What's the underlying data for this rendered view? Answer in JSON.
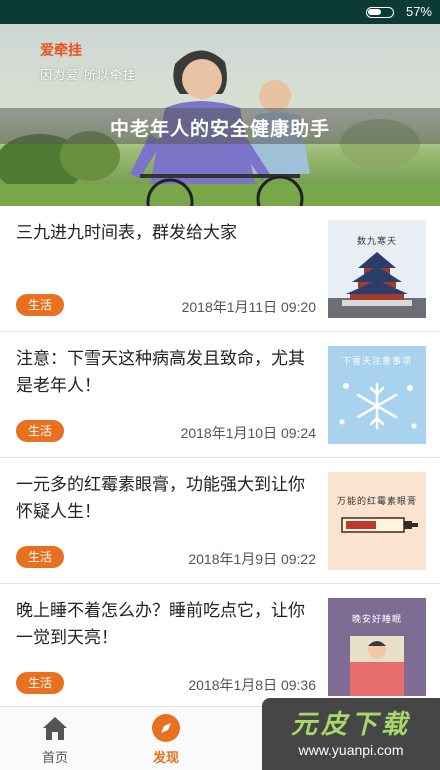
{
  "status_bar": {
    "battery_percent": 57,
    "battery_text": "57%"
  },
  "banner": {
    "brand": "爱牵挂",
    "slogan": "因为爱 所以牵挂",
    "caption": "中老年人的安全健康助手"
  },
  "articles": [
    {
      "title": "三九进九时间表，群发给大家",
      "tag": "生活",
      "date": "2018年1月11日 09:20",
      "thumb_text": "数九寒天",
      "thumb_icon": "temple-of-heaven-icon"
    },
    {
      "title": "注意：下雪天这种病高发且致命，尤其是老年人！",
      "tag": "生活",
      "date": "2018年1月10日 09:24",
      "thumb_text": "下雪天注意事项",
      "thumb_icon": "snowflake-icon"
    },
    {
      "title": "一元多的红霉素眼膏，功能强大到让你怀疑人生！",
      "tag": "生活",
      "date": "2018年1月9日 09:22",
      "thumb_text": "万能的红霉素眼膏",
      "thumb_icon": "ointment-tube-icon"
    },
    {
      "title": "晚上睡不着怎么办？睡前吃点它，让你一觉到天亮！",
      "tag": "生活",
      "date": "2018年1月8日 09:36",
      "thumb_text": "晚安好睡眠",
      "thumb_icon": "sleeping-person-icon"
    }
  ],
  "bottom_nav": {
    "home": {
      "label": "首页",
      "icon": "home-icon",
      "color": "#555555"
    },
    "discover": {
      "label": "发现",
      "icon": "compass-icon",
      "color": "#e8701f"
    }
  },
  "watermark": {
    "title": "元皮下载",
    "url": "www.yuanpi.com"
  },
  "colors": {
    "accent": "#e8701f",
    "status_bar": "#0b3b34",
    "thumb_blue": "#a9d2ee",
    "thumb_peach": "#fbe3cf",
    "thumb_purple": "#7f6c95"
  }
}
